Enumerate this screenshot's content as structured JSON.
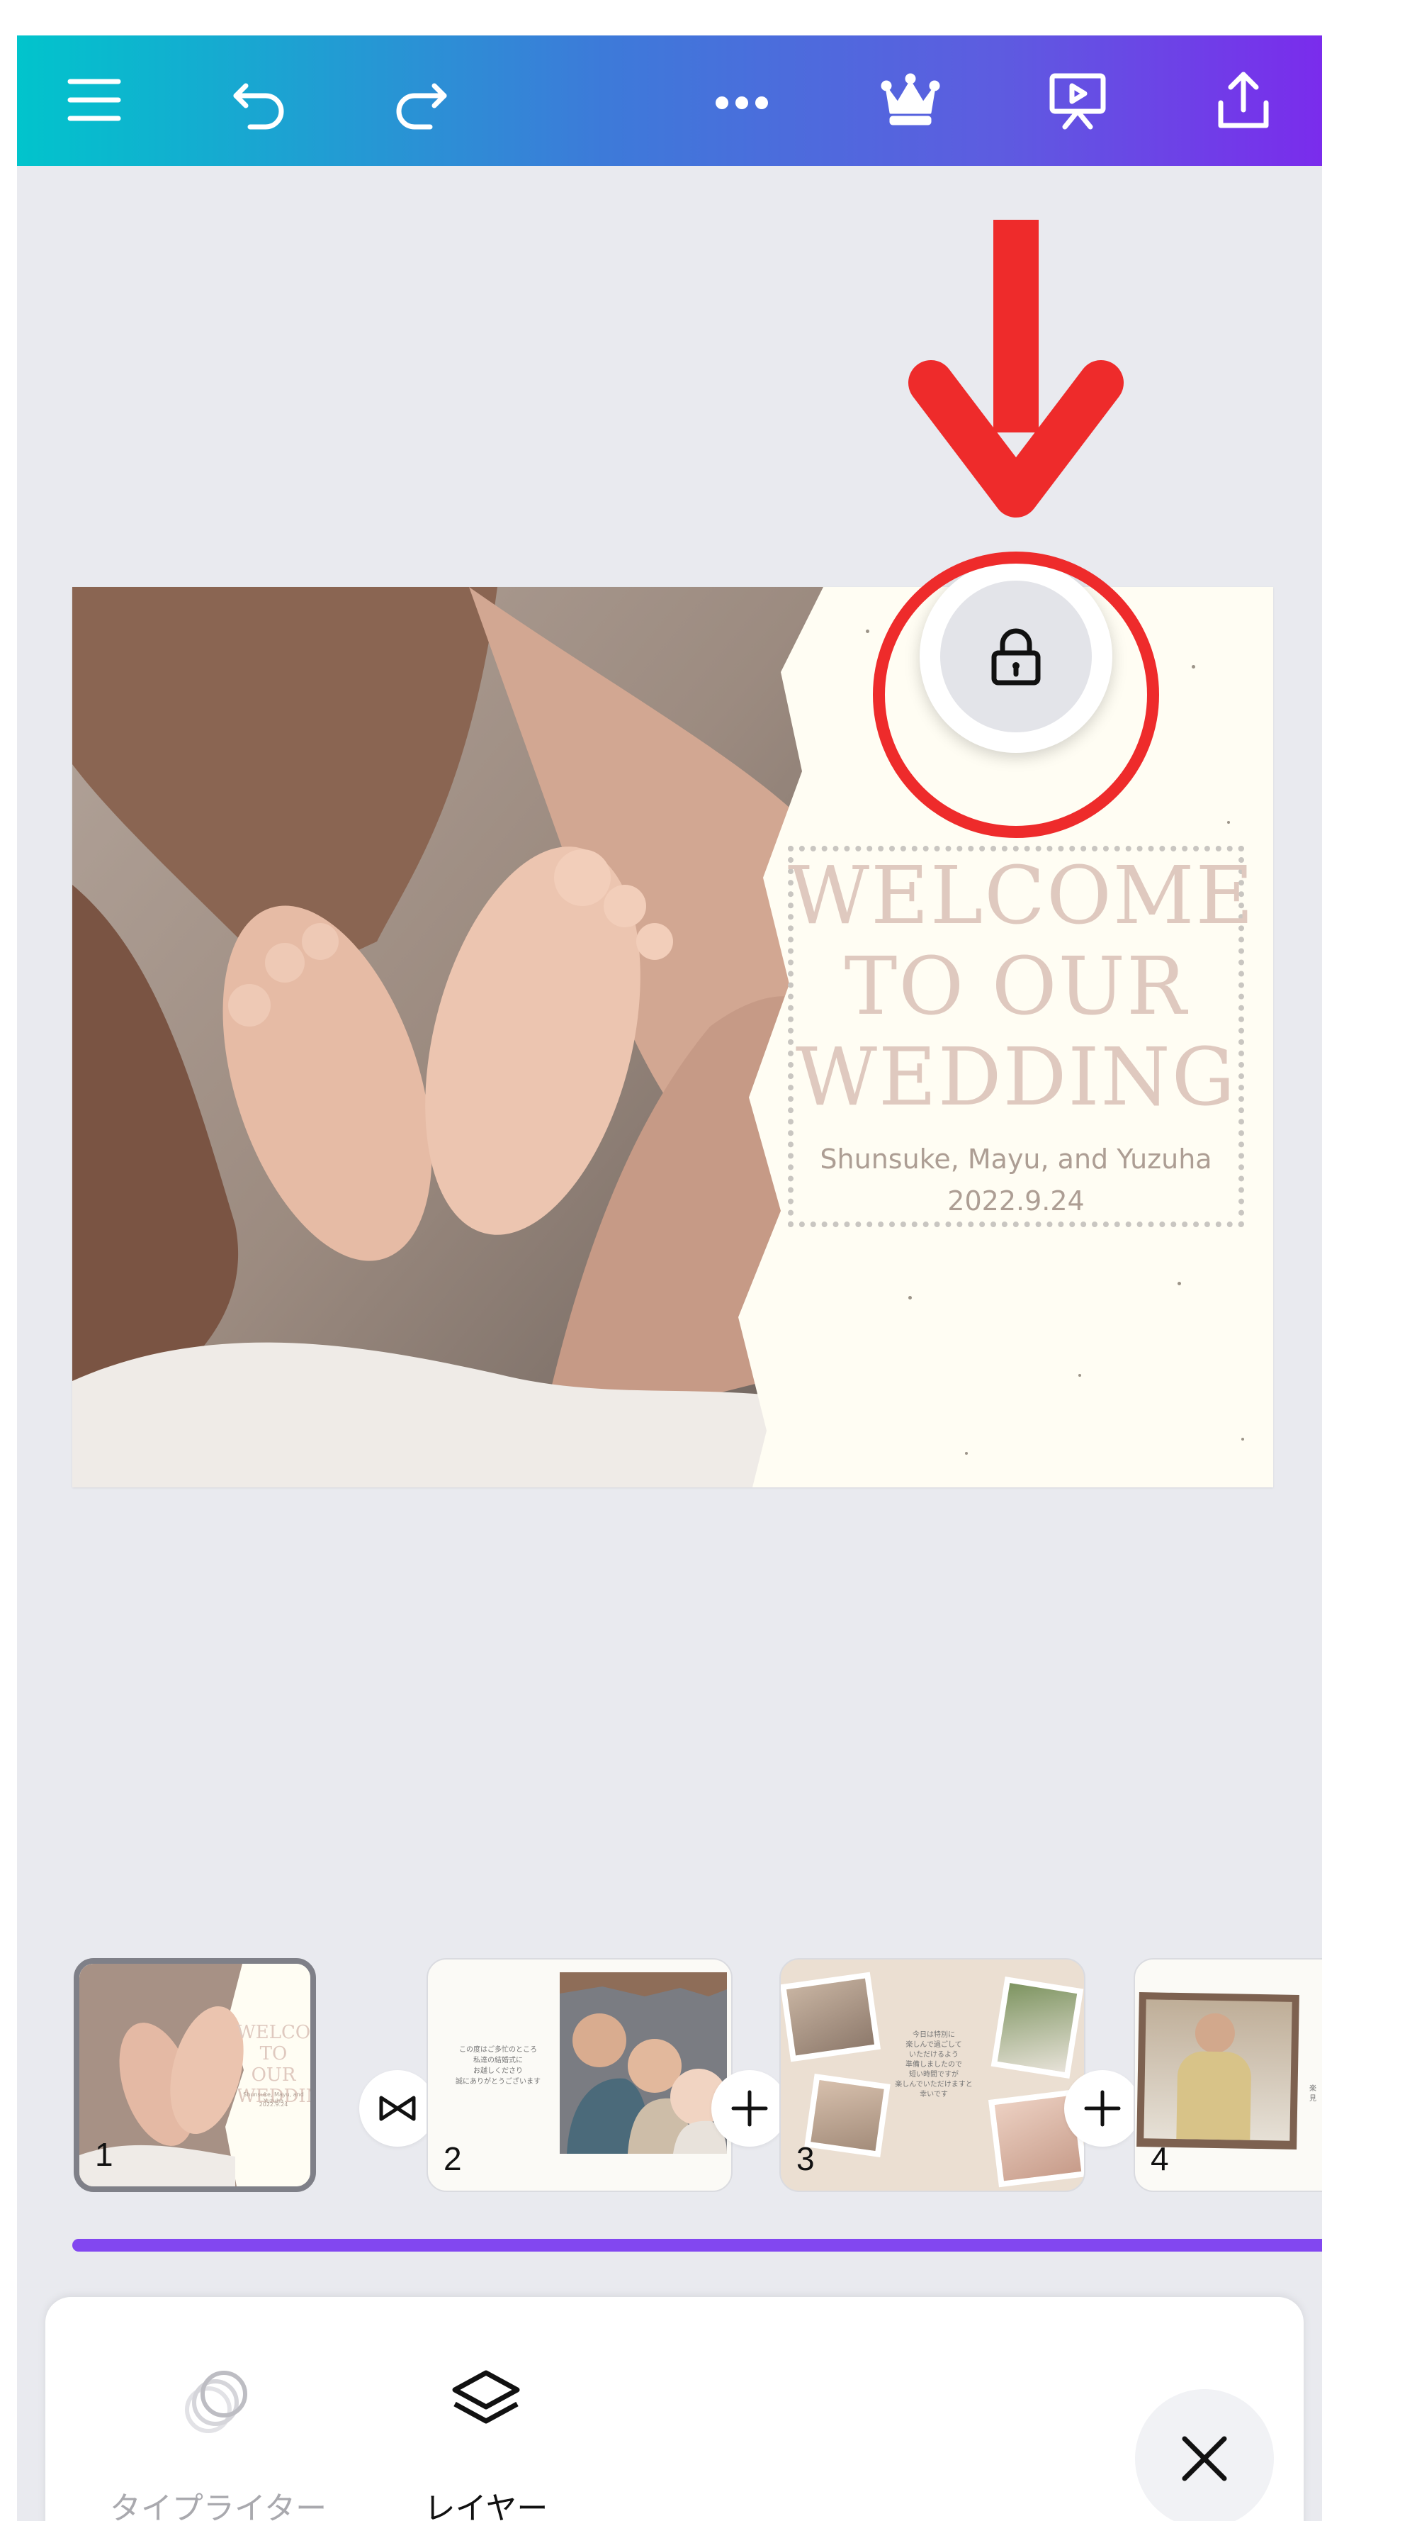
{
  "toolbar": {
    "menu": "menu-icon",
    "undo": "undo-icon",
    "redo": "redo-icon",
    "more": "more-icon",
    "premium": "crown-icon",
    "present": "present-icon",
    "share": "share-icon"
  },
  "canvas": {
    "title_lines": [
      "WELCOME",
      "TO OUR",
      "WEDDING"
    ],
    "names": "Shunsuke, Mayu, and Yuzuha",
    "date": "2022.9.24",
    "lock_icon": "lock-icon"
  },
  "thumbnails": [
    {
      "number": "1",
      "title_lines": [
        "WELCOME",
        "TO OUR",
        "WEDDING"
      ],
      "names": "Shunsuke, Mayu, and Yuzuha",
      "date": "2022.9.24",
      "selected": true
    },
    {
      "number": "2",
      "text_lines": [
        "この度はご多忙のところ",
        "私達の結婚式に",
        "お越しくださり",
        "誠にありがとうございます"
      ]
    },
    {
      "number": "3",
      "text_lines": [
        "今日は特別に",
        "楽しんで過ごして",
        "いただけるよう",
        "準備しましたので",
        "短い時間ですが",
        "楽しんでいただけますと",
        "幸いです"
      ]
    },
    {
      "number": "4",
      "text_lines": [
        "楽",
        "見"
      ]
    }
  ],
  "transitions": [
    "bowtie-icon",
    "plus-icon",
    "plus-icon"
  ],
  "colors": {
    "accent": "#8247f0",
    "annotation": "#ee2b2b",
    "title": "#dfc9bf",
    "subtitle": "#ad9e94"
  },
  "bottom_panel": {
    "typewriter": "タイプライター",
    "layer": "レイヤー",
    "close_icon": "close-icon"
  }
}
